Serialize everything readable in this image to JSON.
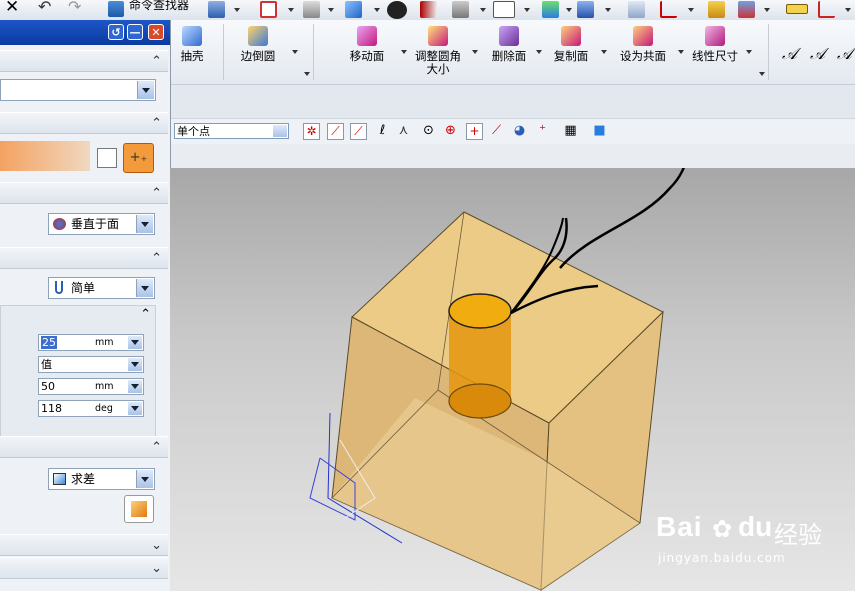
{
  "topbar": {
    "command_finder": "命令查找器"
  },
  "ribbon": {
    "buttons": [
      {
        "label": "抽壳"
      },
      {
        "label": "边倒圆"
      },
      {
        "label": "移动面"
      },
      {
        "label": "调整圆角大小"
      },
      {
        "label": "删除面"
      },
      {
        "label": "复制面"
      },
      {
        "label": "设为共面"
      },
      {
        "label": "线性尺寸"
      }
    ]
  },
  "selbar": {
    "snap_filter": "单个点"
  },
  "panel": {
    "vector_option": "垂直于面",
    "shape_type": "简单",
    "params": [
      {
        "value": "25",
        "unit": "mm"
      },
      {
        "value": "值",
        "unit": ""
      },
      {
        "value": "50",
        "unit": "mm"
      },
      {
        "value": "118",
        "unit": "deg"
      }
    ],
    "boolean": "求差"
  },
  "watermark": {
    "brand_en": "Bai",
    "brand_en2": "du",
    "brand_cn": "经验",
    "url": "jingyan.baidu.com"
  },
  "colors": {
    "title_bar": "#0b3aa0",
    "block_fill": "#e8c47f",
    "cylinder": "#e89a12",
    "accent_orange": "#f39a3a"
  }
}
